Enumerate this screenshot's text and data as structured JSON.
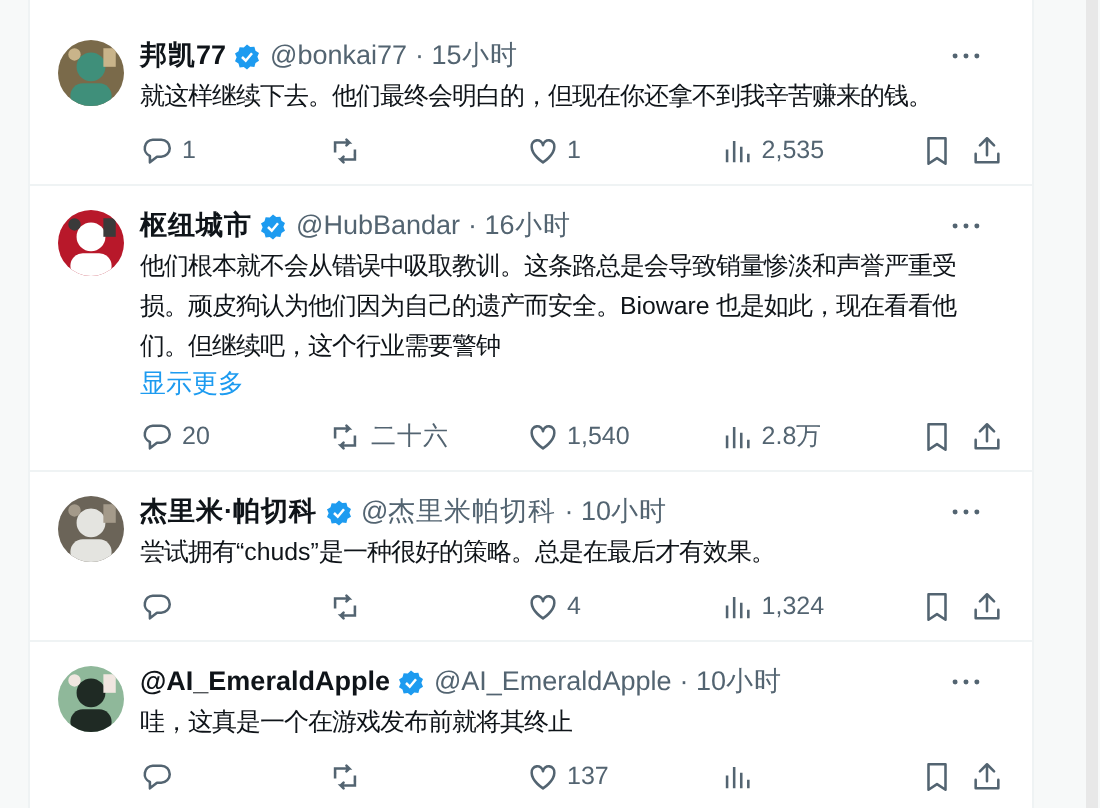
{
  "tweets": [
    {
      "name": "邦凯77",
      "handle": "@bonkai77",
      "time": "· 15小时",
      "verified": true,
      "text": "就这样继续下去。他们最终会明白的，但现在你还拿不到我辛苦赚来的钱。",
      "stats": {
        "replies": "1",
        "likes": "1",
        "views": "2,535"
      }
    },
    {
      "name": "枢纽城市",
      "handle": "@HubBandar",
      "time": "· 16小时",
      "verified": true,
      "text": "他们根本就不会从错误中吸取教训。这条路总是会导致销量惨淡和声誉严重受损。顽皮狗认为他们因为自己的遗产而安全。Bioware 也是如此，现在看看他们。但继续吧，这个行业需要警钟",
      "show_more": "显示更多",
      "stats": {
        "replies": "20",
        "retweets": "二十六",
        "likes": "1,540",
        "views": "2.8万"
      }
    },
    {
      "name": "杰里米·帕切科",
      "handle": "@杰里米帕切科",
      "time": "· 10小时",
      "verified": true,
      "text": "尝试拥有“chuds”是一种很好的策略。总是在最后才有效果。",
      "stats": {
        "likes": "4",
        "views": "1,324"
      }
    },
    {
      "name": "@AI_EmeraldApple",
      "handle": "@AI_EmeraldApple",
      "time": "· 10小时",
      "verified": true,
      "text": "哇，这真是一个在游戏发布前就将其终止",
      "stats": {
        "likes": "137"
      }
    }
  ]
}
